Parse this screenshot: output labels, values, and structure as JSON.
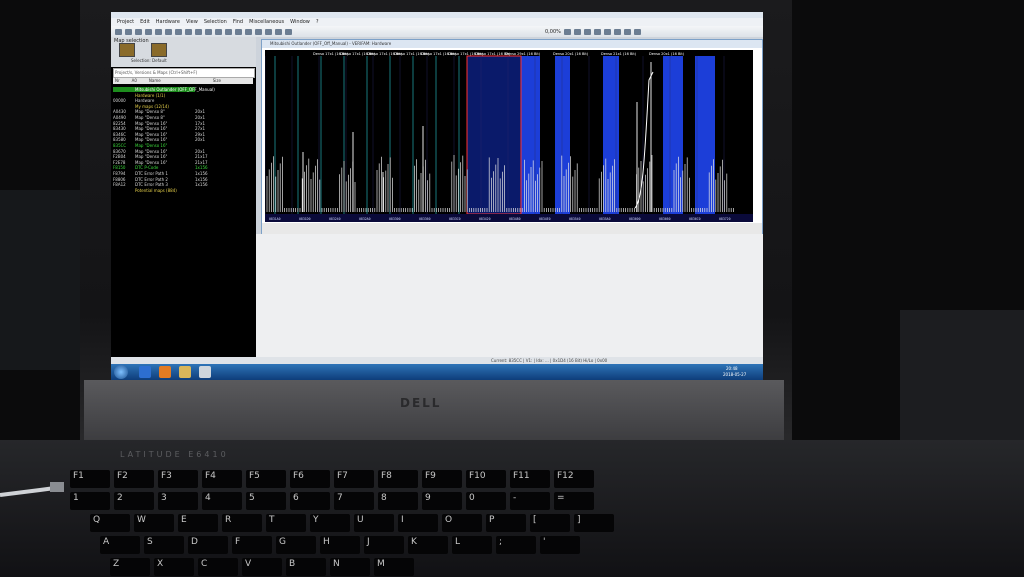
{
  "laptop": {
    "brand": "DELL",
    "model": "LATITUDE E6410"
  },
  "app": {
    "menu": [
      "Project",
      "Edit",
      "Hardware",
      "View",
      "Selection",
      "Find",
      "Miscellaneous",
      "Window",
      "?"
    ],
    "zoom_text": "0,00%",
    "sidebar_title": "Map selection",
    "sidebar_label": "Selection: Default",
    "search_placeholder": "Project/s, Versions & Maps (Ctrl+Shift+F)",
    "columns": [
      "Nr",
      "A0",
      "Name",
      "Size"
    ],
    "tree": [
      {
        "addr": "",
        "name": "Mitsubishi Outlander (OFF_OFF_Manual)",
        "size": "",
        "cls": "hl"
      },
      {
        "addr": "",
        "name": "Hardware (1/1)",
        "size": "",
        "cls": "y"
      },
      {
        "addr": "00000",
        "name": "Hardware",
        "size": "",
        "cls": "w"
      },
      {
        "addr": "",
        "name": "My maps (12/14)",
        "size": "",
        "cls": "y"
      },
      {
        "addr": "A0430",
        "name": "Map \"Denso 8\"",
        "size": "20x1",
        "cls": "w"
      },
      {
        "addr": "A0490",
        "name": "Map \"Denso 8\"",
        "size": "20x1",
        "cls": "w"
      },
      {
        "addr": "82254",
        "name": "Map \"Denso 16\"",
        "size": "17x1",
        "cls": "w"
      },
      {
        "addr": "83430",
        "name": "Map \"Denso 16\"",
        "size": "27x1",
        "cls": "w"
      },
      {
        "addr": "8346C",
        "name": "Map \"Denso 16\"",
        "size": "29x1",
        "cls": "w"
      },
      {
        "addr": "83580",
        "name": "Map \"Denso 16\"",
        "size": "20x1",
        "cls": "w"
      },
      {
        "addr": "835CC",
        "name": "Map \"Denso 16\"",
        "size": "",
        "cls": "g"
      },
      {
        "addr": "83670",
        "name": "Map \"Denso 16\"",
        "size": "20x1",
        "cls": "w"
      },
      {
        "addr": "F2B04",
        "name": "Map \"Denso 16\"",
        "size": "21x17",
        "cls": "w"
      },
      {
        "addr": "F2E78",
        "name": "Map \"Denso 16\"",
        "size": "21x17",
        "cls": "w"
      },
      {
        "addr": "F8150",
        "name": "DTC P-Code",
        "size": "1x156",
        "cls": "g"
      },
      {
        "addr": "F8794",
        "name": "DTC Error Path 1",
        "size": "1x156",
        "cls": "w"
      },
      {
        "addr": "F8806",
        "name": "DTC Error Path 2",
        "size": "1x156",
        "cls": "w"
      },
      {
        "addr": "F8A12",
        "name": "DTC Error Path 3",
        "size": "1x156",
        "cls": "w"
      },
      {
        "addr": "",
        "name": "Potential maps (884)",
        "size": "",
        "cls": "y"
      }
    ],
    "map_window_title": "Mitsubishi Outlander (OFF_Off_Manual) - VERIFAM: Hardware",
    "header_labels": [
      "Denso 17x1 (16 Bit)",
      "Denso 17x1 (16 Bit)",
      "Denso 17x1 (16 Bit)",
      "Denso 17x1 (16 Bit)",
      "Denso 17x1 (16 Bit)",
      "Denso 17x1 (16 Bit)",
      "Denso 17x1 (16 Bit)",
      "Denso 29x1 (16 Bit)",
      "Denso 20x1 (16 Bit)",
      "Denso 21x1 (16 Bit)",
      "Denso 20x1 (16 Bit)"
    ],
    "x_ticks": [
      "0831A0",
      "0831D0",
      "083240",
      "0832A0",
      "083300",
      "083360",
      "0833C0",
      "083420",
      "083480",
      "0834E0",
      "083540",
      "0835A0",
      "083600",
      "083660",
      "0836C0",
      "083720"
    ],
    "status_text": "Current: 835CC | V1: | Idx: ... | 0x1D4 (16 Bit) Hi/Lo | 0x00",
    "clock_time": "20:48",
    "clock_date": "2018-05-27",
    "colors": {
      "plot_bg": "#000000",
      "blue_band": "#1c3ed8",
      "selected": "#ff3030",
      "tree_green": "#3cdc3c"
    }
  }
}
